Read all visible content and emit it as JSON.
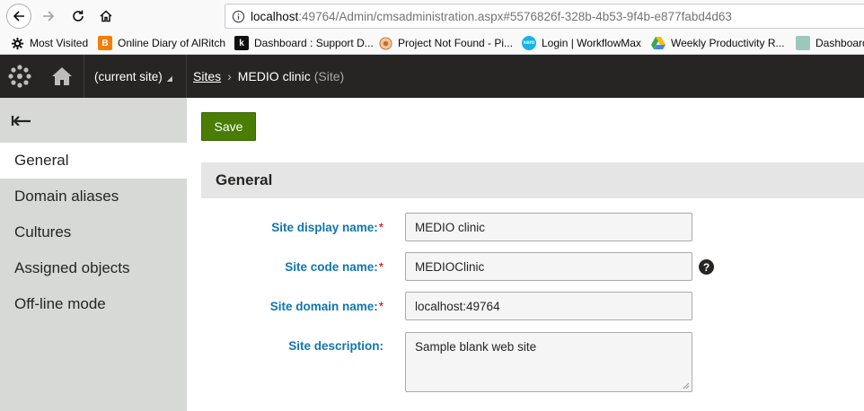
{
  "browser": {
    "url_host": "localhost",
    "url_rest": ":49764/Admin/cmsadministration.aspx#5576826f-328b-4b53-9f4b-e877fabd4d63",
    "bookmarks": [
      {
        "label": "Most Visited",
        "icon": "gear-icon",
        "color": "#4a4a4f"
      },
      {
        "label": "Online Diary of AlRitch",
        "icon": "blogger-icon",
        "color": "#f57d00"
      },
      {
        "label": "Dashboard : Support D...",
        "icon": "k-logo-icon",
        "color": "#111111"
      },
      {
        "label": "Project Not Found - Pi...",
        "icon": "pivotal-icon",
        "color": "#e08b3a"
      },
      {
        "label": "Login | WorkflowMax",
        "icon": "xero-icon",
        "color": "#13b5ea"
      },
      {
        "label": "Weekly Productivity R...",
        "icon": "drive-icon",
        "color": "#34a853"
      },
      {
        "label": "Dashboard",
        "icon": "app-icon",
        "color": "#7fb3a6"
      }
    ]
  },
  "header": {
    "site_selector": "(current site)",
    "breadcrumb_root": "Sites",
    "breadcrumb_current": "MEDIO clinic",
    "breadcrumb_type": "(Site)"
  },
  "sidebar": {
    "items": [
      {
        "label": "General",
        "active": true
      },
      {
        "label": "Domain aliases",
        "active": false
      },
      {
        "label": "Cultures",
        "active": false
      },
      {
        "label": "Assigned objects",
        "active": false
      },
      {
        "label": "Off-line mode",
        "active": false
      }
    ]
  },
  "toolbar": {
    "save_label": "Save"
  },
  "form": {
    "section_title": "General",
    "fields": [
      {
        "label": "Site display name:",
        "value": "MEDIO clinic",
        "required": true
      },
      {
        "label": "Site code name:",
        "value": "MEDIOClinic",
        "required": true
      },
      {
        "label": "Site domain name:",
        "value": "localhost:49764",
        "required": true
      },
      {
        "label": "Site description:",
        "value": "Sample blank web site",
        "required": false
      }
    ],
    "required_marker": "*",
    "help_glyph": "?"
  },
  "colors": {
    "header_bg": "#262524",
    "sidebar_bg": "#d6d9d6",
    "save_bg": "#497d04",
    "label_color": "#1175ae",
    "required_color": "#c70000"
  }
}
